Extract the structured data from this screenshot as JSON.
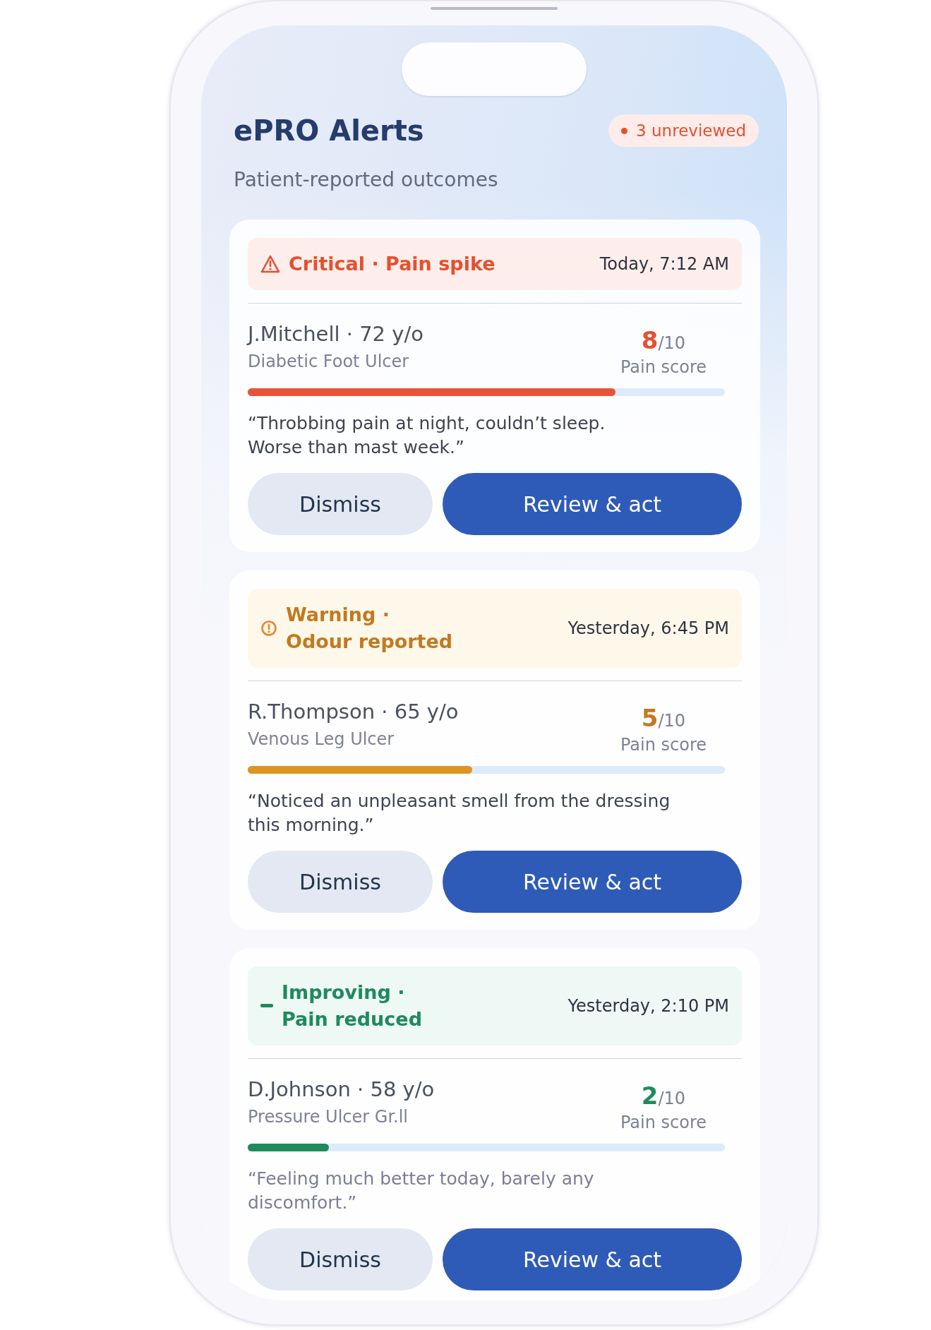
{
  "header": {
    "title": "ePRO Alerts",
    "badge": "3 unreviewed",
    "subtitle": "Patient-reported outcomes"
  },
  "alerts": [
    {
      "kind": "critical",
      "label": "Critical · Pain spike",
      "time": "Today, 7:12 AM",
      "patient": "J.Mitchell · 72 y/o",
      "diagnosis": "Diabetic Foot Ulcer",
      "score": "8",
      "scale": "/10",
      "score_label": "Pain score",
      "level": 0.77,
      "quote": "“Throbbing pain at night, couldn’t sleep.\nWorse than mast week.”",
      "dismiss": "Dismiss",
      "action": "Review & act"
    },
    {
      "kind": "warning",
      "label": "Warning ·\nOdour reported",
      "time": "Yesterday, 6:45 PM",
      "patient": "R.Thompson · 65 y/o",
      "diagnosis": "Venous Leg Ulcer",
      "score": "5",
      "scale": "/10",
      "score_label": "Pain score",
      "level": 0.47,
      "quote": "“Noticed an unpleasant smell from the dressing this morning.”",
      "dismiss": "Dismiss",
      "action": "Review & act"
    },
    {
      "kind": "improving",
      "label": "Improving ·\nPain reduced",
      "time": "Yesterday, 2:10 PM",
      "patient": "D.Johnson · 58 y/o",
      "diagnosis": "Pressure Ulcer Gr.ll",
      "score": "2",
      "scale": "/10",
      "score_label": "Pain score",
      "level": 0.17,
      "quote": "“Feeling much better today, barely any discomfort.”",
      "dismiss": "Dismiss",
      "action": "Review & act"
    }
  ]
}
